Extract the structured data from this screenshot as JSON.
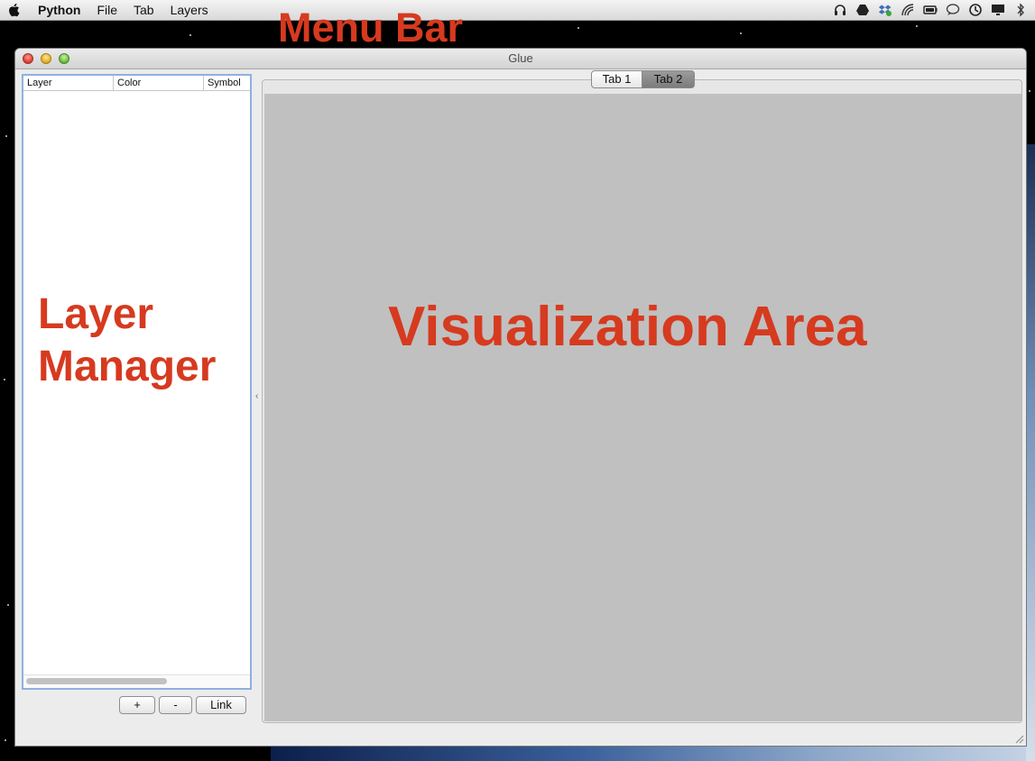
{
  "menubar": {
    "app_name": "Python",
    "items": [
      "File",
      "Tab",
      "Layers"
    ],
    "status_icons": [
      "headphones-icon",
      "drive-icon",
      "dropbox-icon",
      "wifi-icon",
      "battery-icon",
      "chat-icon",
      "time-machine-icon",
      "display-icon",
      "bluetooth-icon"
    ]
  },
  "window": {
    "title": "Glue"
  },
  "layer_manager": {
    "columns": [
      "Layer",
      "Color",
      "Symbol"
    ],
    "buttons": {
      "add": "+",
      "remove": "-",
      "link": "Link"
    }
  },
  "tabs": [
    {
      "label": "Tab 1",
      "active": false
    },
    {
      "label": "Tab 2",
      "active": true
    }
  ],
  "annotations": {
    "menu_bar": "Menu Bar",
    "layer_manager_line1": "Layer",
    "layer_manager_line2": "Manager",
    "visualization_area": "Visualization Area"
  },
  "colors": {
    "annotation": "#d63a1f",
    "viz_background": "#c0c0c0",
    "selection_border": "#8fb0e0"
  }
}
